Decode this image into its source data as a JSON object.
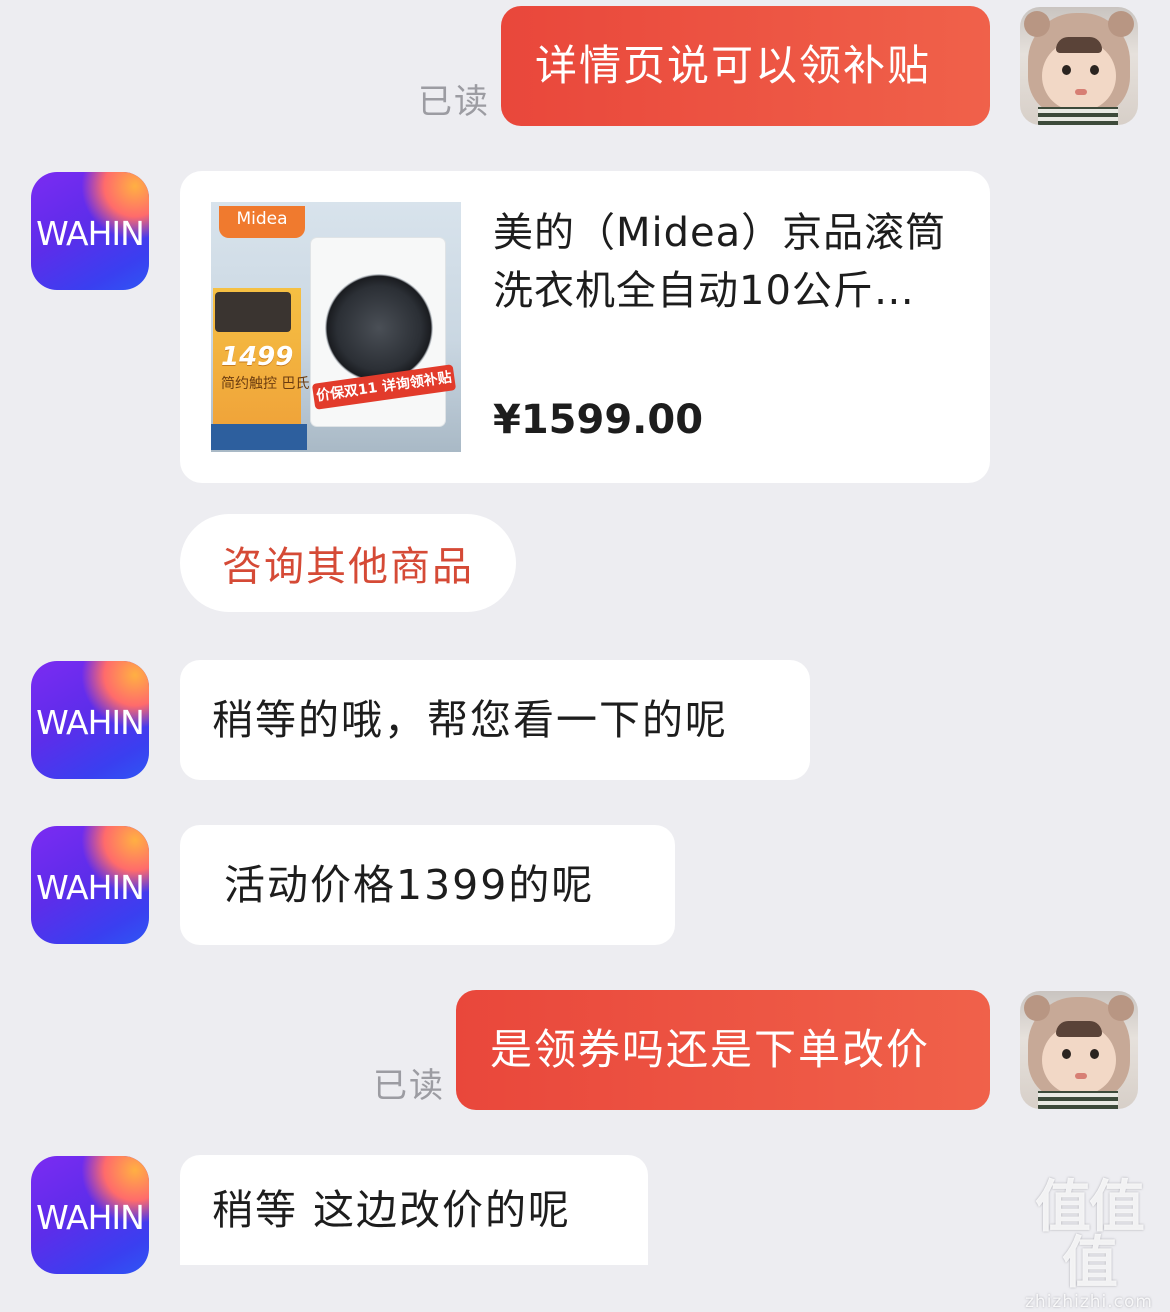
{
  "messages": {
    "m1": {
      "text": "详情页说可以领补贴",
      "status": "已读"
    },
    "product": {
      "title": "美的（Midea）京品滚筒洗衣机全自动10公斤…",
      "price": "¥1599.00",
      "thumb_brand": "Midea",
      "thumb_price": "1499",
      "thumb_feature": "简约触控 巴氏除菌洗",
      "thumb_banner": "价保双11 详询领补贴"
    },
    "consult_button": "咨询其他商品",
    "m2": {
      "text": "稍等的哦，帮您看一下的呢"
    },
    "m3": {
      "text": "活动价格1399的呢"
    },
    "m4": {
      "text": "是领券吗还是下单改价",
      "status": "已读"
    },
    "m5": {
      "text": "稍等 这边改价的呢"
    }
  },
  "brand": {
    "avatar_text": "WAHIN"
  },
  "watermark": {
    "logo": "值值值",
    "site": "zhizhizhi.com"
  },
  "colors": {
    "sent_bubble": "#ec5240",
    "consult_text": "#d54a36",
    "background": "#ededf1"
  }
}
